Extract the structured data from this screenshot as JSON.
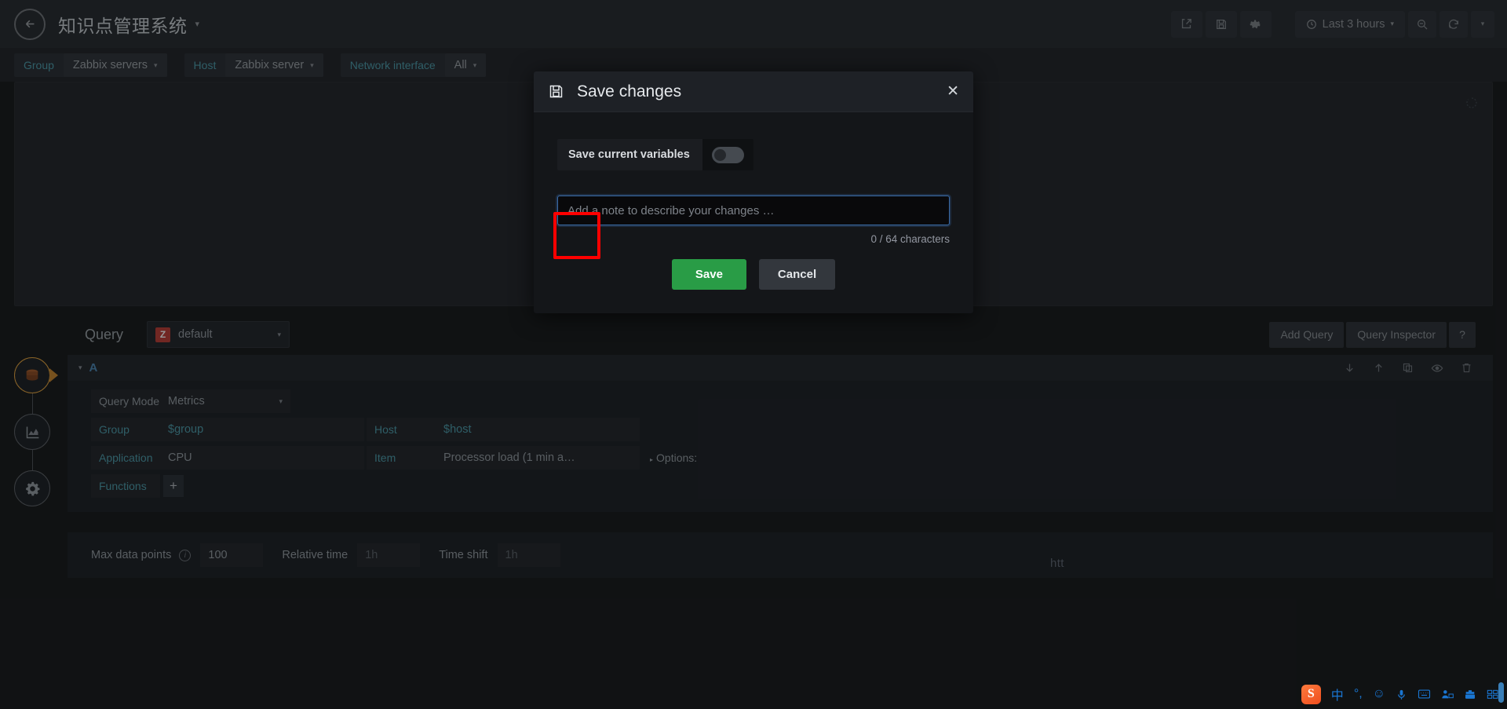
{
  "navbar": {
    "back_icon": "arrow-left-icon",
    "dashboard_title": "知识点管理系统",
    "title_caret": "▾",
    "actions": [
      {
        "name": "share-dashboard-button",
        "icon": "share-icon"
      },
      {
        "name": "save-dashboard-button",
        "icon": "save-floppy-icon"
      },
      {
        "name": "dashboard-settings-button",
        "icon": "gear-icon"
      }
    ],
    "time_picker": {
      "icon": "clock-icon",
      "label": "Last 3 hours",
      "caret": "▾"
    },
    "zoom_out_icon": "zoom-out-icon",
    "refresh_icon": "refresh-icon",
    "refresh_caret": "▾"
  },
  "variables": [
    {
      "label": "Group",
      "value": "Zabbix servers",
      "caret": "▾"
    },
    {
      "label": "Host",
      "value": "Zabbix server",
      "caret": "▾"
    },
    {
      "label": "Network interface",
      "value": "All",
      "caret": "▾"
    }
  ],
  "rail": [
    {
      "name": "rail-node-queries",
      "icon": "database-icon",
      "active": true
    },
    {
      "name": "rail-node-visualization",
      "icon": "area-chart-icon",
      "active": false
    },
    {
      "name": "rail-node-general-settings",
      "icon": "gear-wrench-icon",
      "active": false
    }
  ],
  "editor": {
    "query_label": "Query",
    "datasource": {
      "logo": "Z",
      "name": "default",
      "caret": "▾"
    },
    "add_query_label": "Add Query",
    "query_inspector_label": "Query Inspector",
    "help_label": "?",
    "row": {
      "collapse_caret": "▾",
      "ref_id": "A",
      "actions": [
        {
          "name": "move-query-down-icon",
          "glyph": "↓"
        },
        {
          "name": "move-query-up-icon",
          "glyph": "↑"
        },
        {
          "name": "duplicate-query-icon",
          "glyph": "⧉"
        },
        {
          "name": "toggle-query-visibility-icon",
          "glyph": "◉"
        },
        {
          "name": "delete-query-icon",
          "glyph": "🗑"
        }
      ],
      "query_mode_label": "Query Mode",
      "query_mode_value": "Metrics",
      "query_mode_caret": "▾",
      "group_label": "Group",
      "group_value": "$group",
      "host_label": "Host",
      "host_value": "$host",
      "application_label": "Application",
      "application_value": "CPU",
      "item_label": "Item",
      "item_value": "Processor load (1 min a…",
      "options_label": "Options:",
      "options_tri": "▸",
      "functions_label": "Functions",
      "functions_add": "+"
    },
    "options": {
      "max_data_points_label": "Max data points",
      "max_data_points_value": "100",
      "relative_time_label": "Relative time",
      "relative_time_placeholder": "1h",
      "time_shift_label": "Time shift",
      "time_shift_placeholder": "1h"
    }
  },
  "modal": {
    "icon": "save-floppy-icon",
    "title": "Save changes",
    "close": "✕",
    "save_variables_label": "Save current variables",
    "toggle_state": "off",
    "note_value": "",
    "note_placeholder": "Add a note to describe your changes …",
    "char_count": "0 / 64 characters",
    "save_label": "Save",
    "cancel_label": "Cancel"
  },
  "overlay": {
    "watermark": "htt",
    "highlight_color": "#ff0000"
  },
  "ime": {
    "logo": "S",
    "items": [
      {
        "name": "ime-language-mode-icon",
        "glyph": "中"
      },
      {
        "name": "ime-punctuation-icon",
        "glyph": "°,"
      },
      {
        "name": "ime-emoji-icon",
        "glyph": "☺"
      },
      {
        "name": "ime-voice-input-icon",
        "glyph": "🎤"
      },
      {
        "name": "ime-soft-keyboard-icon",
        "glyph": "⌨"
      },
      {
        "name": "ime-user-icon",
        "glyph": "👤"
      },
      {
        "name": "ime-toolbox-icon",
        "glyph": "🧰"
      },
      {
        "name": "ime-apps-icon",
        "glyph": "▦"
      }
    ]
  }
}
